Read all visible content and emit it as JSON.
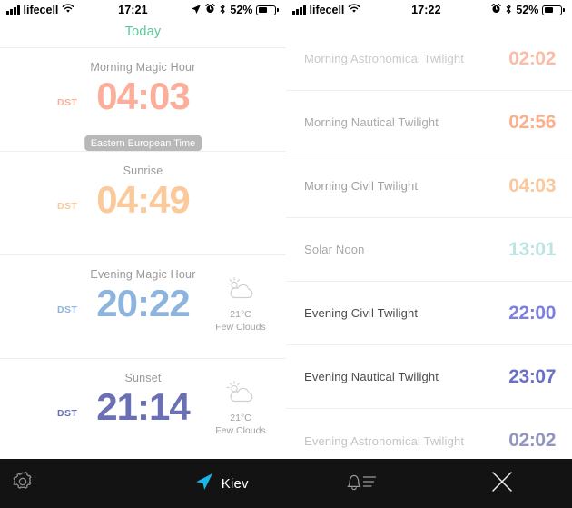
{
  "status_bar_left": {
    "signal_icon": "signal-bars-icon",
    "carrier": "lifecell",
    "wifi_icon": "wifi-icon",
    "time": "17:21",
    "location_arrow_icon": "location-arrow-icon",
    "alarm_icon": "alarm-clock-icon",
    "bluetooth_icon": "bluetooth-icon",
    "battery_percent": "52%",
    "battery_icon": "battery-icon"
  },
  "status_bar_right": {
    "signal_icon": "signal-bars-icon",
    "carrier": "lifecell",
    "wifi_icon": "wifi-icon",
    "time": "17:22",
    "alarm_icon": "alarm-clock-icon",
    "bluetooth_icon": "bluetooth-icon",
    "battery_percent": "52%",
    "battery_icon": "battery-icon"
  },
  "left_panel": {
    "header": {
      "label": "Today",
      "color": "#5BC99A"
    },
    "tooltip": {
      "text": "Eastern European Time",
      "bg": "#b8b8b8"
    },
    "events": [
      {
        "title": "Morning Magic Hour",
        "dst_label": "DST",
        "time": "04:03",
        "color": "#FBAF9A",
        "has_tooltip": true,
        "weather": null
      },
      {
        "title": "Sunrise",
        "dst_label": "DST",
        "time": "04:49",
        "color": "#FBC99A",
        "has_tooltip": false,
        "weather": null
      },
      {
        "title": "Evening Magic Hour",
        "dst_label": "DST",
        "time": "20:22",
        "color": "#8DB4DF",
        "has_tooltip": false,
        "weather": {
          "icon": "sun-behind-cloud-icon",
          "temperature": "21°C",
          "condition": "Few Clouds"
        }
      },
      {
        "title": "Sunset",
        "dst_label": "DST",
        "time": "21:14",
        "color": "#6B70B5",
        "has_tooltip": false,
        "weather": {
          "icon": "sun-behind-cloud-icon",
          "temperature": "21°C",
          "condition": "Few Clouds"
        }
      }
    ]
  },
  "right_panel": {
    "rows": [
      {
        "label": "Morning Astronomical Twilight",
        "time": "02:02",
        "label_color": "#c9c9c9",
        "time_color": "#FBBCA8"
      },
      {
        "label": "Morning Nautical Twilight",
        "time": "02:56",
        "label_color": "#a8a8a8",
        "time_color": "#FBAF8F"
      },
      {
        "label": "Morning Civil Twilight",
        "time": "04:03",
        "label_color": "#a0a0a0",
        "time_color": "#FAC89C"
      },
      {
        "label": "Solar Noon",
        "time": "13:01",
        "label_color": "#a8a8a8",
        "time_color": "#BEE3E3"
      },
      {
        "label": "Evening Civil Twilight",
        "time": "22:00",
        "label_color": "#4c4c4c",
        "time_color": "#7C7FE0"
      },
      {
        "label": "Evening Nautical Twilight",
        "time": "23:07",
        "label_color": "#4c4c4c",
        "time_color": "#6A6FC9"
      },
      {
        "label": "Evening Astronomical Twilight",
        "time": "02:02",
        "label_color": "#c4c4c4",
        "time_color": "#9295BE"
      }
    ]
  },
  "toolbar": {
    "background": "#131313",
    "settings_icon": "gear-icon",
    "location_arrow_icon": "location-arrow-icon",
    "location_name": "Kiev",
    "location_accent": "#18B7E8",
    "notifications_icon": "bell-list-icon",
    "close_icon": "close-x-icon"
  }
}
